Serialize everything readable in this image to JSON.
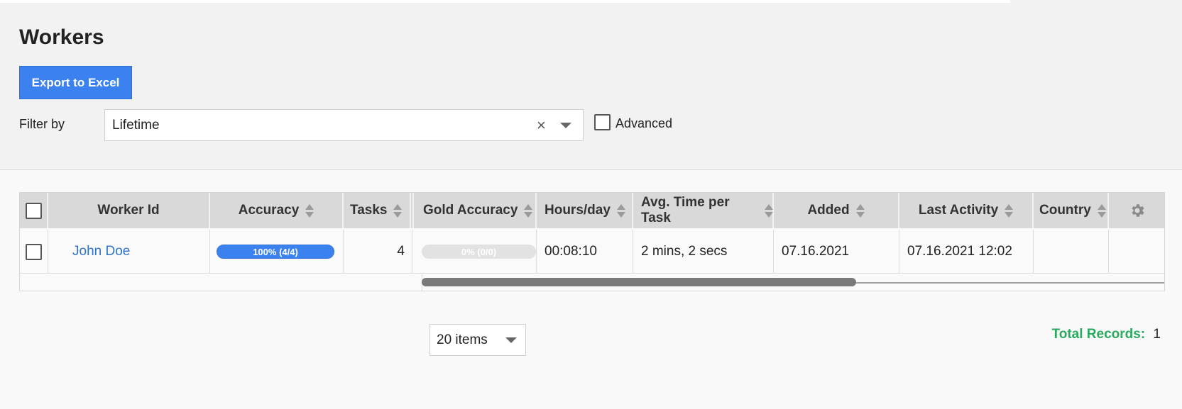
{
  "page": {
    "title": "Workers"
  },
  "toolbar": {
    "export_label": "Export to Excel"
  },
  "filter": {
    "label": "Filter by",
    "value": "Lifetime",
    "clear_symbol": "×",
    "advanced_label": "Advanced",
    "advanced_checked": false
  },
  "grid": {
    "columns": [
      {
        "label": "Worker Id",
        "sortable": false
      },
      {
        "label": "Accuracy",
        "sortable": true
      },
      {
        "label": "Tasks",
        "sortable": true
      },
      {
        "label": "Gold Accuracy",
        "sortable": true
      },
      {
        "label": "Hours/day",
        "sortable": true
      },
      {
        "label": "Avg. Time per Task",
        "sortable": true
      },
      {
        "label": "Added",
        "sortable": true
      },
      {
        "label": "Last Activity",
        "sortable": true
      },
      {
        "label": "Country",
        "sortable": true
      }
    ],
    "rows": [
      {
        "worker_id": "John Doe",
        "accuracy_text": "100% (4/4)",
        "accuracy_fraction": 1.0,
        "tasks": "4",
        "gold_accuracy_text": "0% (0/0)",
        "gold_accuracy_fraction": 0.0,
        "hours_per_day": "00:08:10",
        "avg_time_per_task": "2 mins, 2 secs",
        "added": "07.16.2021",
        "last_activity": "07.16.2021 12:02",
        "country": ""
      }
    ],
    "settings_icon": "gear-icon",
    "horizontal_scroll_position": 0.0
  },
  "pager": {
    "page_size_label": "20 items"
  },
  "summary": {
    "total_label": "Total Records:",
    "total_value": "1"
  },
  "colors": {
    "primary": "#3b82f0",
    "link": "#2e75c9",
    "total_label": "#2aaa5e",
    "header_bg": "#d9d9d9"
  }
}
